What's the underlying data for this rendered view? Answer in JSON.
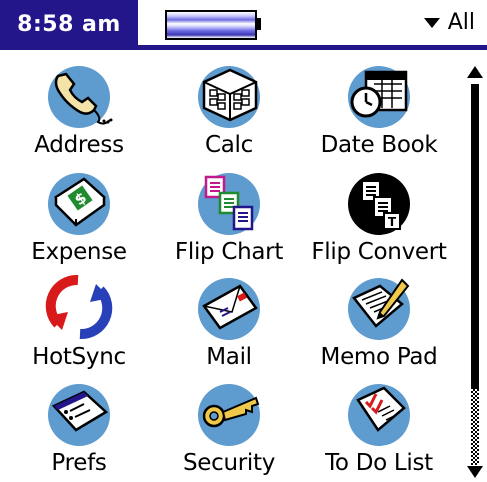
{
  "status_bar": {
    "time": "8:58 am",
    "category": "All",
    "accent_color": "#23168a"
  },
  "apps": [
    {
      "label": "Address",
      "icon": "phone-icon"
    },
    {
      "label": "Calc",
      "icon": "calculator-icon"
    },
    {
      "label": "Date Book",
      "icon": "calendar-clock-icon"
    },
    {
      "label": "Expense",
      "icon": "dollar-book-icon"
    },
    {
      "label": "Flip Chart",
      "icon": "flip-chart-icon"
    },
    {
      "label": "Flip Convert",
      "icon": "flip-convert-icon"
    },
    {
      "label": "HotSync",
      "icon": "hotsync-icon"
    },
    {
      "label": "Mail",
      "icon": "envelope-icon"
    },
    {
      "label": "Memo Pad",
      "icon": "memo-pencil-icon"
    },
    {
      "label": "Prefs",
      "icon": "prefs-window-icon"
    },
    {
      "label": "Security",
      "icon": "key-icon"
    },
    {
      "label": "To Do List",
      "icon": "checklist-icon"
    }
  ]
}
